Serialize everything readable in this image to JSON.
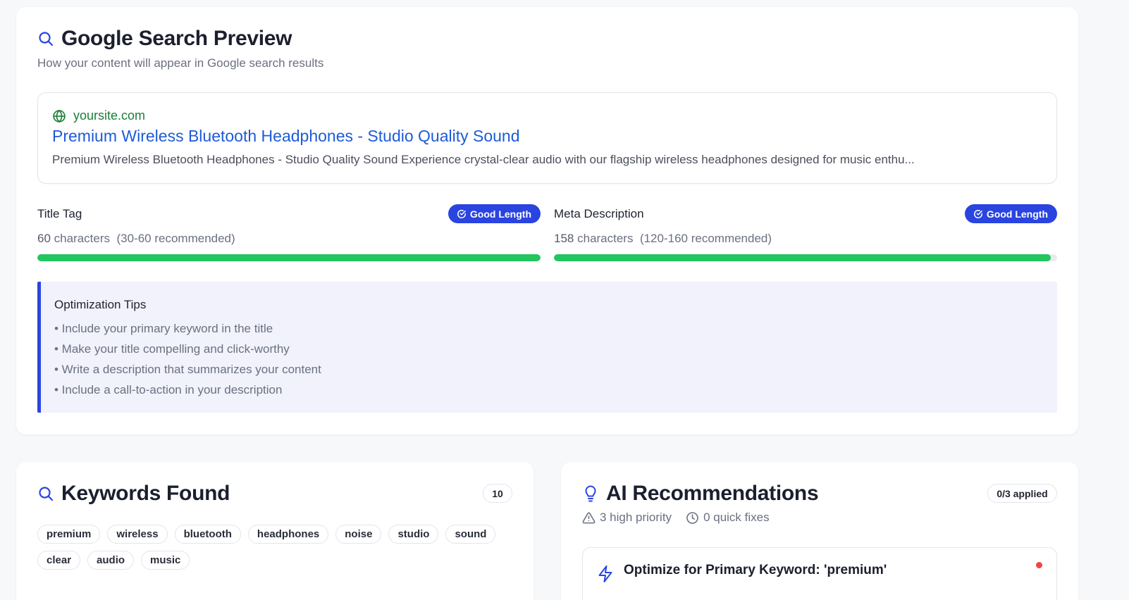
{
  "colors": {
    "accent": "#2a44e0",
    "success": "#22c55e",
    "link": "#1d5bd8",
    "url": "#1a7f37",
    "danger": "#ef4444"
  },
  "preview": {
    "title": "Google Search Preview",
    "title_icon": "search-icon",
    "subtitle": "How your content will appear in Google search results",
    "serp": {
      "url": "yoursite.com",
      "url_icon": "globe-icon",
      "title": "Premium Wireless Bluetooth Headphones - Studio Quality Sound",
      "description": "Premium Wireless Bluetooth Headphones - Studio Quality Sound Experience crystal-clear audio with our flagship wireless headphones designed for music enthu..."
    },
    "title_tag": {
      "label": "Title Tag",
      "badge": "Good Length",
      "count": "60",
      "unit": "characters",
      "recommended": "(30-60 recommended)",
      "progress_percent": 100
    },
    "meta_description": {
      "label": "Meta Description",
      "badge": "Good Length",
      "count": "158",
      "unit": "characters",
      "recommended": "(120-160 recommended)",
      "progress_percent": 98.75
    },
    "tips": {
      "title": "Optimization Tips",
      "items": [
        "• Include your primary keyword in the title",
        "• Make your title compelling and click-worthy",
        "• Write a description that summarizes your content",
        "• Include a call-to-action in your description"
      ]
    }
  },
  "keywords": {
    "title": "Keywords Found",
    "title_icon": "search-icon",
    "count": "10",
    "tags": [
      "premium",
      "wireless",
      "bluetooth",
      "headphones",
      "noise",
      "studio",
      "sound",
      "clear",
      "audio",
      "music"
    ]
  },
  "ai": {
    "title": "AI Recommendations",
    "title_icon": "lightbulb-icon",
    "applied": "0/3 applied",
    "high_priority": "3 high priority",
    "quick_fixes": "0 quick fixes",
    "first_recommendation": {
      "icon": "lightning-icon",
      "title": "Optimize for Primary Keyword: 'premium'"
    }
  }
}
